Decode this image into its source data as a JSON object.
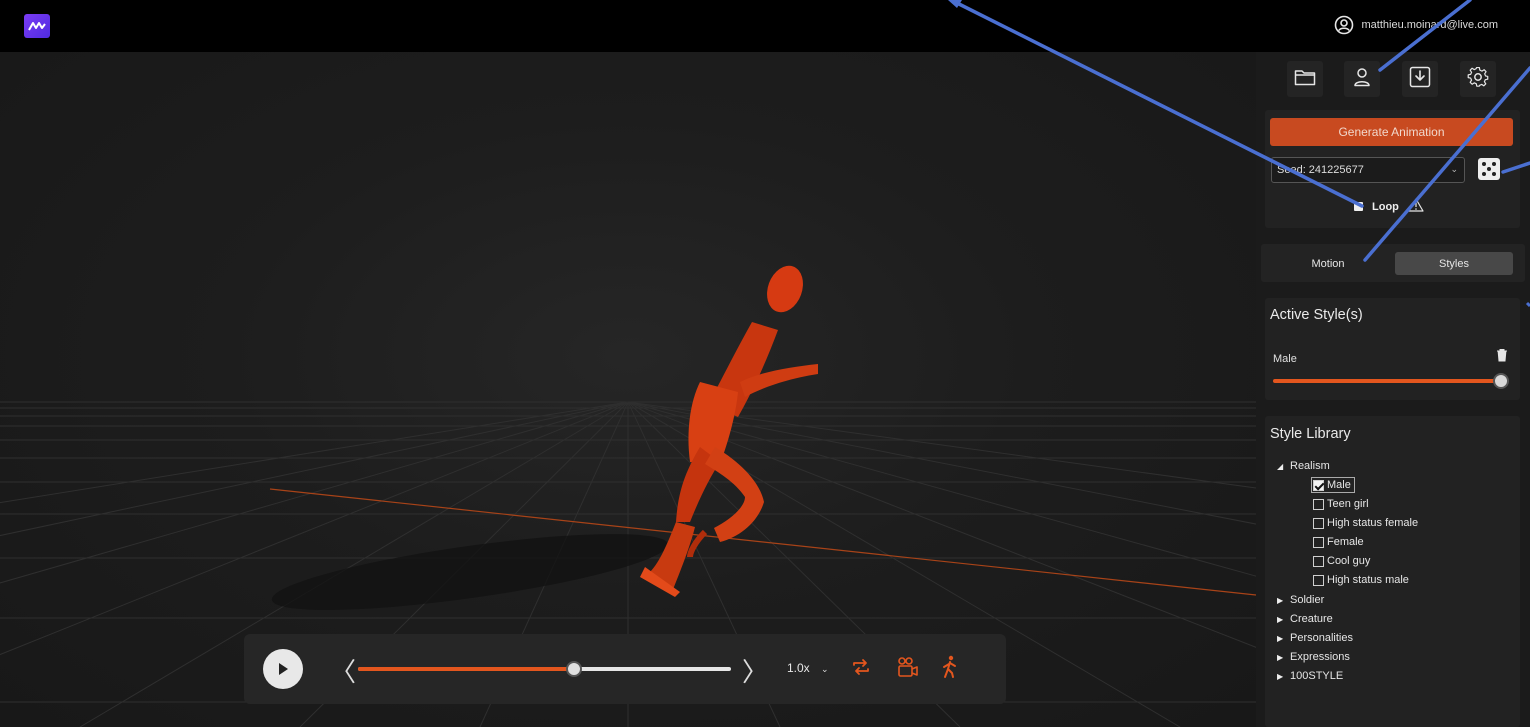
{
  "header": {
    "logo_icon": "app-logo-icon",
    "user_email": "matthieu.moinard@live.com"
  },
  "toolbar": {
    "items": [
      {
        "icon": "folder-icon"
      },
      {
        "icon": "user-icon"
      },
      {
        "icon": "download-icon"
      },
      {
        "icon": "gear-icon"
      }
    ]
  },
  "generate": {
    "button_label": "Generate Animation",
    "seed_label": "Seed: 241225677",
    "loop_label": "Loop",
    "loop_checked": true
  },
  "tabs": [
    {
      "label": "Motion",
      "active": false
    },
    {
      "label": "Styles",
      "active": true
    }
  ],
  "active_styles": {
    "title": "Active Style(s)",
    "items": [
      {
        "name": "Male",
        "weight": 1.0
      }
    ]
  },
  "style_library": {
    "title": "Style Library",
    "groups": [
      {
        "label": "Realism",
        "expanded": true
      },
      {
        "label": "Soldier",
        "expanded": false
      },
      {
        "label": "Creature",
        "expanded": false
      },
      {
        "label": "Personalities",
        "expanded": false
      },
      {
        "label": "Expressions",
        "expanded": false
      },
      {
        "label": "100STYLE",
        "expanded": false
      }
    ],
    "realism_items": [
      {
        "label": "Male",
        "checked": true
      },
      {
        "label": "Teen girl",
        "checked": false
      },
      {
        "label": "High status female",
        "checked": false
      },
      {
        "label": "Female",
        "checked": false
      },
      {
        "label": "Cool guy",
        "checked": false
      },
      {
        "label": "High status male",
        "checked": false
      }
    ]
  },
  "player": {
    "progress": 0.58,
    "speed_label": "1.0x",
    "prev_glyph": "〈",
    "next_glyph": "〉"
  },
  "colors": {
    "accent": "#e3561e",
    "generate_button": "#c84a20",
    "annotation_arrow": "#4a6fd1",
    "character": "#d63a12"
  }
}
